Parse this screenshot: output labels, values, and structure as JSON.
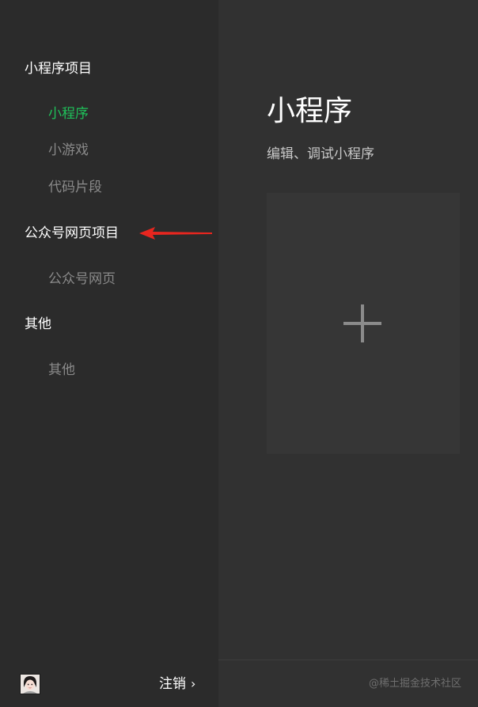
{
  "sidebar": {
    "sections": [
      {
        "title": "小程序项目",
        "items": [
          "小程序",
          "小游戏",
          "代码片段"
        ]
      },
      {
        "title": "公众号网页项目",
        "items": [
          "公众号网页"
        ]
      },
      {
        "title": "其他",
        "items": [
          "其他"
        ]
      }
    ],
    "active_item": "小程序",
    "footer": {
      "logout_label": "注销",
      "logout_chevron": "›"
    }
  },
  "main": {
    "title": "小程序",
    "subtitle": "编辑、调试小程序",
    "new_project_icon": "plus-icon"
  },
  "watermark": "@稀土掘金技术社区",
  "colors": {
    "sidebar_bg": "#2b2b2b",
    "main_bg": "#313131",
    "active_green": "#1fc15a",
    "annotation_red": "#e8261f"
  }
}
